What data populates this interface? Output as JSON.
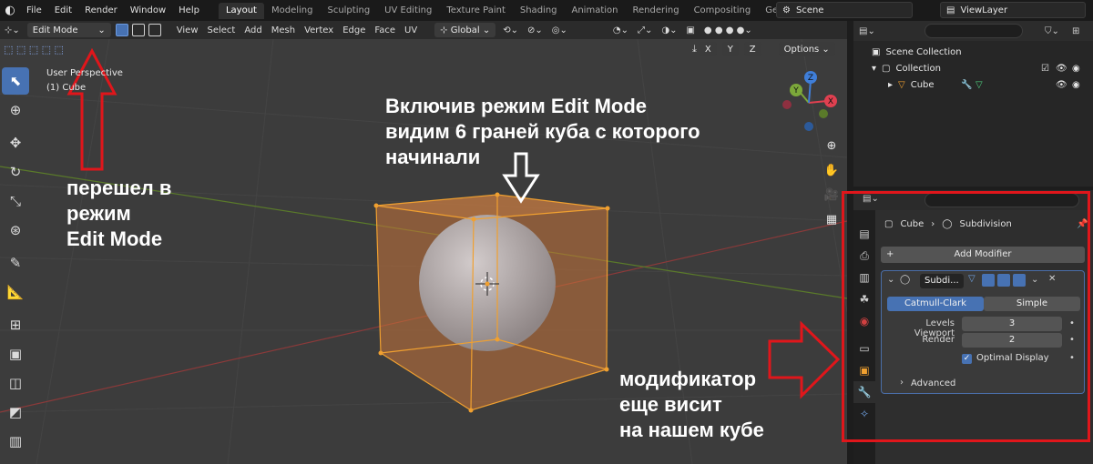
{
  "menu": {
    "items": [
      "File",
      "Edit",
      "Render",
      "Window",
      "Help"
    ],
    "workspaces": [
      "Layout",
      "Modeling",
      "Sculpting",
      "UV Editing",
      "Texture Paint",
      "Shading",
      "Animation",
      "Rendering",
      "Compositing",
      "Geomet"
    ],
    "active_workspace": "Layout",
    "scene": "Scene",
    "view_layer": "ViewLayer"
  },
  "viewport_header": {
    "mode": "Edit Mode",
    "menus": [
      "View",
      "Select",
      "Add",
      "Mesh",
      "Vertex",
      "Edge",
      "Face",
      "UV"
    ],
    "transform_orientation": "Global",
    "axes": [
      "X",
      "Y",
      "Z"
    ],
    "options_label": "Options"
  },
  "viewport": {
    "perspective": "User Perspective",
    "object_label": "(1) Cube",
    "gizmo": {
      "x": "X",
      "y": "Y",
      "z": "Z"
    }
  },
  "annotations": {
    "left": "перешел в\nрежим\nEdit Mode",
    "top": "Включив режим Edit Mode\nвидим 6 граней куба с которого\nначинали",
    "right": "модификатор\nеще висит\nна нашем кубе",
    "color_red": "#e0161b",
    "color_white": "#ffffff"
  },
  "outliner": {
    "scene_collection": "Scene Collection",
    "collection": "Collection",
    "object": "Cube"
  },
  "properties": {
    "breadcrumb_object": "Cube",
    "breadcrumb_modifier": "Subdivision",
    "add_modifier": "Add Modifier",
    "modifier_name": "Subdi...",
    "tab_catmull": "Catmull-Clark",
    "tab_simple": "Simple",
    "levels_viewport_label": "Levels Viewport",
    "levels_viewport_value": "3",
    "render_label": "Render",
    "render_value": "2",
    "optimal_display_label": "Optimal Display",
    "advanced_label": "Advanced"
  },
  "colors": {
    "accent": "#4772b3",
    "cube_edge": "#f0a030",
    "cube_face": "#c8743a"
  }
}
